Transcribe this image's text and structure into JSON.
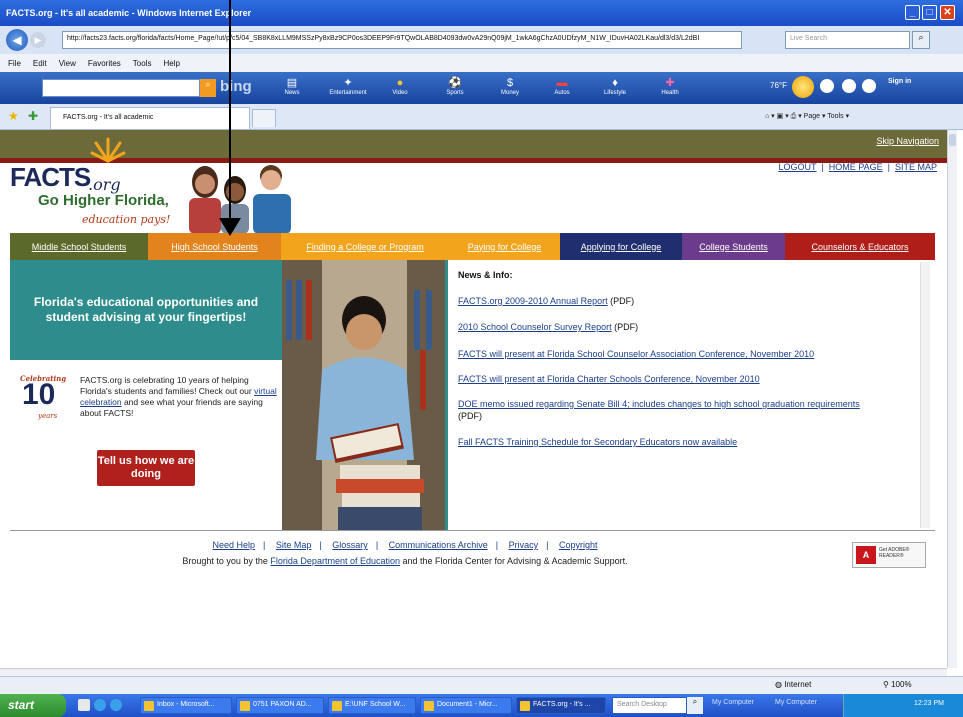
{
  "window": {
    "title": "FACTS.org - It's all academic - Windows Internet Explorer",
    "address": "http://facts23.facts.org/florida/facts/Home_Page/!ut/p/c5/04_SB8K8xLLM9MSSzPy8xBz9CP0os3DEEP9Fr9TQwOLAB8D4093dw0vA29nQ09jM_1wkA6gChzA0UDfzyM_N1W_IDuvHA02LKau/dl3/d3/L2dBI",
    "live_search_placeholder": "Live Search"
  },
  "menu": [
    "File",
    "Edit",
    "View",
    "Favorites",
    "Tools",
    "Help"
  ],
  "bing": {
    "logo": "bing",
    "items": [
      {
        "label": "News",
        "icon": "news-icon",
        "glyph": "▤"
      },
      {
        "label": "Entertainment",
        "icon": "entertainment-icon",
        "glyph": "✦"
      },
      {
        "label": "Video",
        "icon": "video-icon",
        "glyph": "●"
      },
      {
        "label": "Sports",
        "icon": "sports-icon",
        "glyph": "⚽"
      },
      {
        "label": "Money",
        "icon": "money-icon",
        "glyph": "$"
      },
      {
        "label": "Autos",
        "icon": "autos-icon",
        "glyph": "▬"
      },
      {
        "label": "Lifestyle",
        "icon": "lifestyle-icon",
        "glyph": "♦"
      },
      {
        "label": "Health",
        "icon": "health-icon",
        "glyph": "✚"
      }
    ],
    "weather": "76°F",
    "sign_in": "Sign in"
  },
  "tabs": {
    "active": "FACTS.org - It's all academic",
    "commands": "⌂ ▾  ▣ ▾  ⎙ ▾  Page ▾  Tools ▾"
  },
  "page": {
    "skip_nav": "Skip Navigation",
    "logo": {
      "facts": "FACTS",
      "org": ".org",
      "tagline": "Go Higher Florida,",
      "tagline2": "education pays!"
    },
    "top_links": [
      "LOGOUT",
      "HOME PAGE",
      "SITE MAP"
    ],
    "nav": [
      {
        "label": "Middle School Students",
        "color": "#5b6a2a"
      },
      {
        "label": "High School Students",
        "color": "#e2831c"
      },
      {
        "label": "Finding a College or Program",
        "color": "#f2a51c"
      },
      {
        "label": "Paying for College",
        "color": "#f2a51c"
      },
      {
        "label": "Applying for College",
        "color": "#1f2e6e"
      },
      {
        "label": "College Students",
        "color": "#6b3b8c"
      },
      {
        "label": "Counselors & Educators",
        "color": "#b01e1a"
      }
    ],
    "promo": "Florida's educational opportunities and student advising at your fingertips!",
    "celebrate": {
      "badge_top": "Celebrating",
      "badge_num": "10",
      "badge_years": "years",
      "text_before": "FACTS.org is celebrating 10 years of helping Florida's students and families! Check out our ",
      "link": "virtual celebration",
      "text_after": " and see what your friends are saying about FACTS!",
      "button": "Tell us how we are doing"
    },
    "news": {
      "title": "News & Info:",
      "items": [
        {
          "link": "FACTS.org 2009-2010 Annual Report",
          "suffix": " (PDF)"
        },
        {
          "link": "2010 School Counselor Survey Report",
          "suffix": " (PDF)"
        },
        {
          "link": "FACTS will present at Florida School Counselor Association Conference, November 2010",
          "suffix": ""
        },
        {
          "link": "FACTS will present at Florida Charter Schools Conference, November 2010",
          "suffix": ""
        },
        {
          "link": "DOE memo issued regarding Senate Bill 4; includes changes to high school graduation requirements",
          "suffix": " (PDF)"
        },
        {
          "link": "Fall FACTS Training Schedule for Secondary Educators now available",
          "suffix": ""
        }
      ]
    },
    "footer": {
      "links": [
        "Need Help",
        "Site Map",
        "Glossary",
        "Communications Archive",
        "Privacy",
        "Copyright"
      ],
      "text_before": "Brought to you by the ",
      "text_link": "Florida Department of Education",
      "text_after": " and the Florida Center for Advising & Academic Support.",
      "adobe": "Get ADOBE® READER®"
    }
  },
  "status": {
    "zone": "Internet",
    "zoom": "100%"
  },
  "taskbar": {
    "start": "start",
    "tasks": [
      {
        "label": "Inbox - Microsoft..."
      },
      {
        "label": "0751 PAXON AD..."
      },
      {
        "label": "E:\\UNF School W..."
      },
      {
        "label": "Document1 - Micr..."
      },
      {
        "label": "FACTS.org - It's ..."
      }
    ],
    "search_placeholder": "Search Desktop",
    "quick": [
      "My Computer",
      "My Computer"
    ],
    "clock": "12:23 PM"
  }
}
